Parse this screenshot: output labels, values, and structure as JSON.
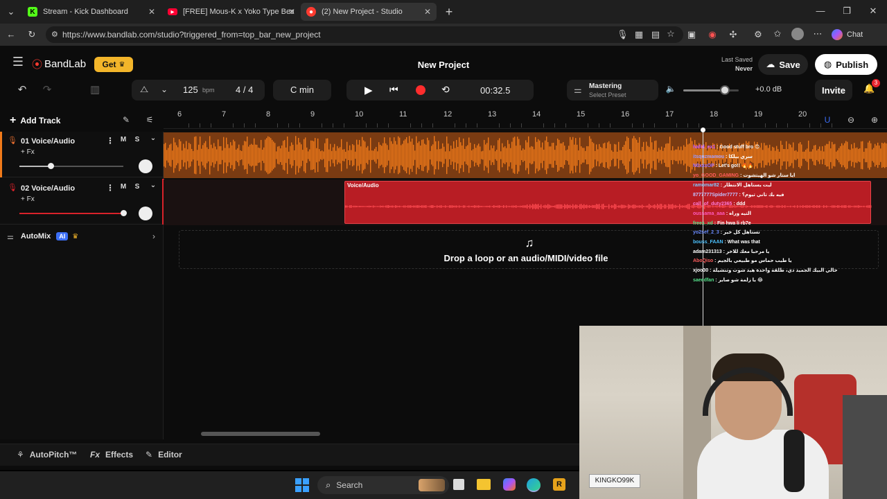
{
  "browser": {
    "tabs": [
      {
        "title": "Stream - Kick Dashboard",
        "active": false
      },
      {
        "title": "[FREE] Mous-K x Yoko Type Beat -",
        "active": false
      },
      {
        "title": "(2) New Project - Studio",
        "active": true
      }
    ],
    "url": "https://www.bandlab.com/studio?triggered_from=top_bar_new_project",
    "chat_label": "Chat",
    "tab_new_icon": "plus-icon"
  },
  "app": {
    "brand": "BandLab",
    "get_label": "Get",
    "project_title": "New Project",
    "last_saved_label": "Last Saved",
    "last_saved_value": "Never",
    "save_label": "Save",
    "publish_label": "Publish",
    "invite_label": "Invite",
    "notification_count": "3"
  },
  "toolbar": {
    "bpm_value": "125",
    "bpm_unit": "bpm",
    "time_signature": "4 / 4",
    "key": "C min",
    "time": "00:32.5",
    "mastering_label": "Mastering",
    "mastering_preset": "Select Preset",
    "volume_db": "+0.0 dB",
    "volume_level": 0.75
  },
  "tracks": {
    "add_track_label": "Add Track",
    "items": [
      {
        "name": "01  Voice/Audio",
        "fx": "+ Fx",
        "mute": "M",
        "solo": "S",
        "volume": 0.3,
        "color": "#f07a1a"
      },
      {
        "name": "02  Voice/Audio",
        "fx": "+ Fx",
        "mute": "M",
        "solo": "S",
        "volume": 1.0,
        "color": "#d9222a"
      }
    ],
    "automix_label": "AutoMix",
    "ai_badge": "AI",
    "region_label": "Voice/Audio",
    "drop_hint": "Drop a loop or an audio/MIDI/video file"
  },
  "ruler": {
    "marks": [
      "6",
      "7",
      "8",
      "9",
      "10",
      "11",
      "12",
      "13",
      "14",
      "15",
      "16",
      "17",
      "18",
      "19",
      "20"
    ]
  },
  "chat_overlay": [
    {
      "user": "hafid_ex1",
      "msg": "Good stuff bro 😊",
      "color": "#c45cff"
    },
    {
      "user": "itsquzmamou",
      "msg": "سري بيلكا",
      "color": "#9a9aff"
    },
    {
      "user": "N0xxxOP",
      "msg": "Let's go!! 🔥🔥",
      "color": "#9a6bff"
    },
    {
      "user": "yo_GOOD_GAMING",
      "msg": "ايا ستار شو الهيتشوت",
      "color": "#ff5b5b"
    },
    {
      "user": "ramomar82",
      "msg": "ليت يستاهل الانتظار",
      "color": "#7fc8ff"
    },
    {
      "user": "8777777Spider7777",
      "msg": "فيه بك تاني تيوم؟",
      "color": "#c0c0ff"
    },
    {
      "user": "call_of_duty2365",
      "msg": "ddd",
      "color": "#ff7ad9"
    },
    {
      "user": "oussama_aaa",
      "msg": "التيه وراه",
      "color": "#ff5bc0"
    },
    {
      "user": "freex_xd",
      "msg": "Fin hwa li rb7e",
      "color": "#55e08a"
    },
    {
      "user": "yo2sef_2_3",
      "msg": "تستاهل كل خير",
      "color": "#6b8bff"
    },
    {
      "user": "bouss_FAAN",
      "msg": "What was that",
      "color": "#4cc2ff"
    },
    {
      "user": "adam231313",
      "msg": "يا مرحبا معك للاخر",
      "color": "#ffffff"
    },
    {
      "user": "AboQiso",
      "msg": "يا طيب حماس مو طبيعي بالجيم",
      "color": "#ff5d5d"
    },
    {
      "user": "xjoo30",
      "msg": "حالي البيك الجميد دي، طلقة واحدة هيد شوت وتنشيلة",
      "color": "#ffffff"
    },
    {
      "user": "saeedfan",
      "msg": "يا زلمة شو صاير 😂",
      "color": "#55e08a"
    }
  ],
  "bottom_bar": {
    "autopitch_label": "AutoPitch™",
    "effects_label": "Effects",
    "editor_label": "Editor"
  },
  "taskbar": {
    "search_label": "Search"
  },
  "webcam": {
    "name_tag": "KINGKO99K"
  }
}
